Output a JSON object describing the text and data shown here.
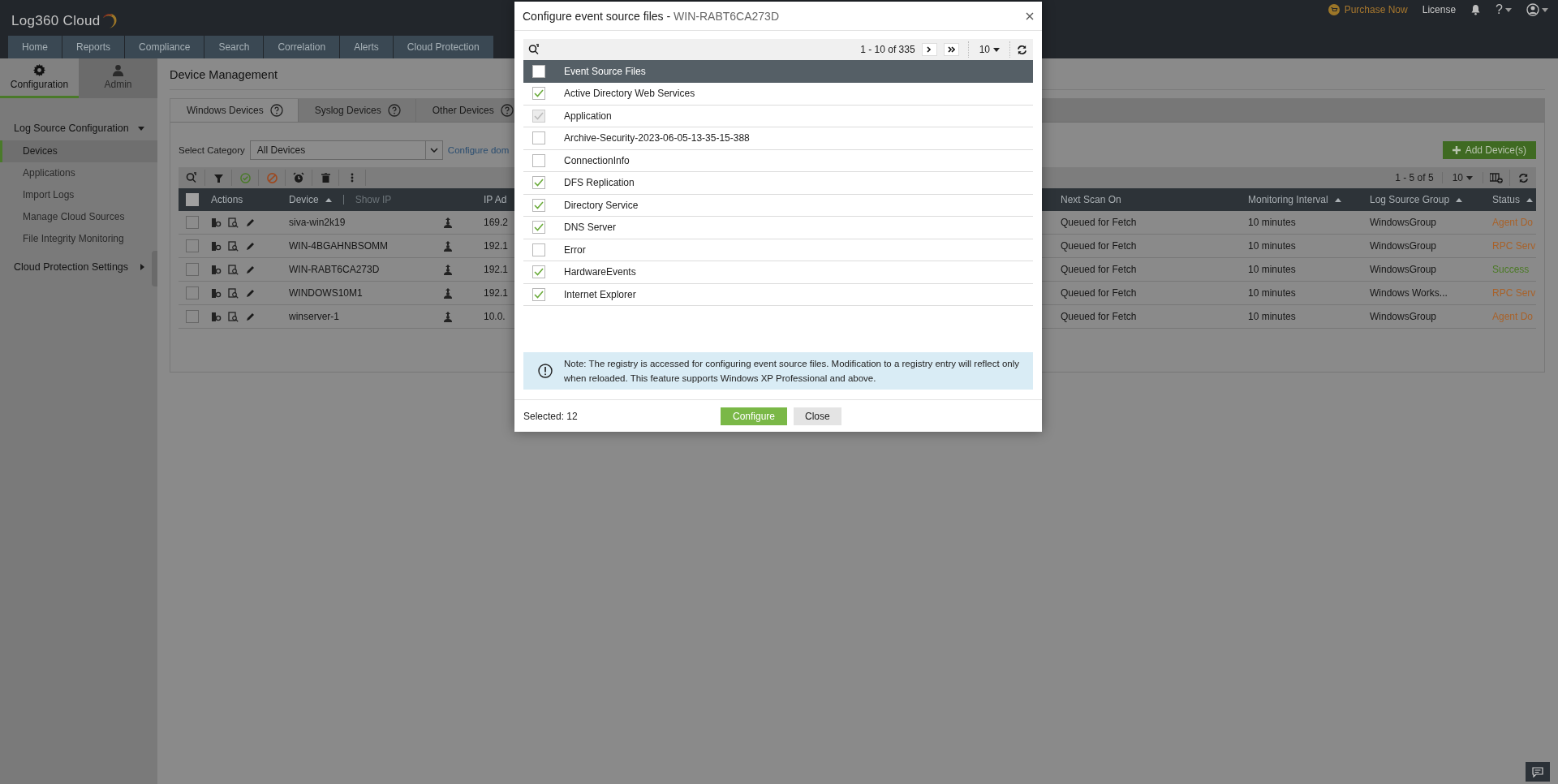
{
  "header": {
    "logo": "Log360 Cloud",
    "purchase": "Purchase Now",
    "license": "License",
    "help": "?"
  },
  "nav": [
    {
      "label": "Home"
    },
    {
      "label": "Reports"
    },
    {
      "label": "Compliance"
    },
    {
      "label": "Search"
    },
    {
      "label": "Correlation"
    },
    {
      "label": "Alerts"
    },
    {
      "label": "Cloud Protection"
    }
  ],
  "sidebar": {
    "tabs": [
      {
        "label": "Configuration",
        "selected": true
      },
      {
        "label": "Admin",
        "selected": false
      }
    ],
    "sections": [
      {
        "title": "Log Source Configuration",
        "expanded": true,
        "items": [
          {
            "label": "Devices",
            "selected": true
          },
          {
            "label": "Applications",
            "selected": false
          },
          {
            "label": "Import Logs",
            "selected": false
          },
          {
            "label": "Manage Cloud Sources",
            "selected": false
          },
          {
            "label": "File Integrity Monitoring",
            "selected": false
          }
        ]
      },
      {
        "title": "Cloud Protection Settings",
        "expanded": false
      }
    ]
  },
  "page_title": "Device Management",
  "device_tabs": [
    {
      "label": "Windows Devices",
      "selected": true
    },
    {
      "label": "Syslog Devices",
      "selected": false
    },
    {
      "label": "Other Devices",
      "selected": false
    }
  ],
  "category": {
    "label": "Select Category",
    "value": "All Devices",
    "link": "Configure dom"
  },
  "add_button": "Add Device(s)",
  "pagination": {
    "range": "1 - 5 of 5",
    "page_size": "10"
  },
  "table": {
    "all_checked": false,
    "columns": {
      "actions": "Actions",
      "device": "Device",
      "show_ip": "Show IP",
      "ip": "IP Ad",
      "next_scan": "Next Scan On",
      "interval": "Monitoring Interval",
      "group": "Log Source Group",
      "status": "Status"
    },
    "rows": [
      {
        "checked": false,
        "device": "siva-win2k19",
        "ip": "169.2",
        "next_scan": "Queued for Fetch",
        "interval": "10 minutes",
        "group": "WindowsGroup",
        "status": "Agent Do",
        "color": "#a8622a"
      },
      {
        "checked": false,
        "device": "WIN-4BGAHNBSOMM",
        "ip": "192.1",
        "next_scan": "Queued for Fetch",
        "interval": "10 minutes",
        "group": "WindowsGroup",
        "status": "RPC Serv",
        "color": "#a8622a"
      },
      {
        "checked": false,
        "device": "WIN-RABT6CA273D",
        "ip": "192.1",
        "next_scan": "Queued for Fetch",
        "interval": "10 minutes",
        "group": "WindowsGroup",
        "status": "Success",
        "color": "#4b7a25"
      },
      {
        "checked": false,
        "device": "WINDOWS10M1",
        "ip": "192.1",
        "next_scan": "Queued for Fetch",
        "interval": "10 minutes",
        "group": "Windows Works...",
        "status": "RPC Serv",
        "color": "#a8622a"
      },
      {
        "checked": false,
        "device": "winserver-1",
        "ip": "10.0.",
        "next_scan": "Queued for Fetch",
        "interval": "10 minutes",
        "group": "WindowsGroup",
        "status": "Agent Do",
        "color": "#a8622a"
      }
    ]
  },
  "modal": {
    "title": "Configure event source files -",
    "device": "WIN-RABT6CA273D",
    "pagination": "1 - 10 of 335",
    "page_size": "10",
    "column": "Event Source Files",
    "all_checked": false,
    "files": [
      {
        "name": "Active Directory Web Services",
        "checked": true,
        "disabled": false
      },
      {
        "name": "Application",
        "checked": true,
        "disabled": true
      },
      {
        "name": "Archive-Security-2023-06-05-13-35-15-388",
        "checked": false,
        "disabled": false
      },
      {
        "name": "ConnectionInfo",
        "checked": false,
        "disabled": false
      },
      {
        "name": "DFS Replication",
        "checked": true,
        "disabled": false
      },
      {
        "name": "Directory Service",
        "checked": true,
        "disabled": false
      },
      {
        "name": "DNS Server",
        "checked": true,
        "disabled": false
      },
      {
        "name": "Error",
        "checked": false,
        "disabled": false
      },
      {
        "name": "HardwareEvents",
        "checked": true,
        "disabled": false
      },
      {
        "name": "Internet Explorer",
        "checked": true,
        "disabled": false
      }
    ],
    "note": "Note: The registry is accessed for configuring event source files. Modification to a registry entry will reflect only when reloaded. This feature supports Windows XP Professional and above.",
    "selected": "Selected: 12",
    "configure": "Configure",
    "close": "Close"
  }
}
